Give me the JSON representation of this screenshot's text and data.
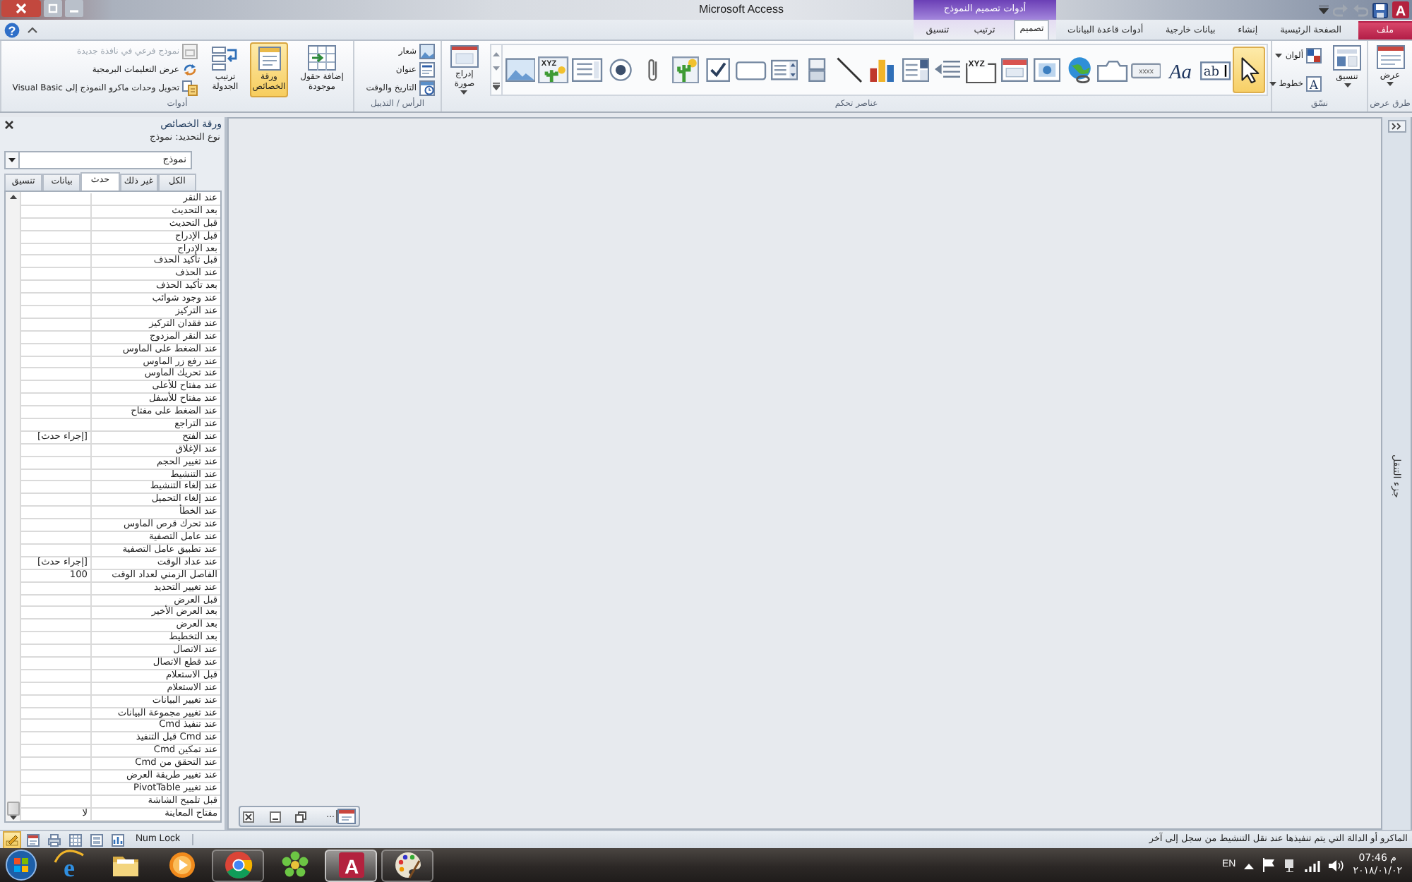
{
  "window": {
    "title": "Microsoft Access",
    "app_glyph": "A",
    "context_title": "أدوات تصميم النموذج",
    "help_glyph": "?"
  },
  "ribbon_tabs": [
    {
      "label": "ملف",
      "kind": "file",
      "selected": false
    },
    {
      "label": "الصفحة الرئيسية",
      "kind": "main",
      "selected": false
    },
    {
      "label": "إنشاء",
      "kind": "main",
      "selected": false
    },
    {
      "label": "بيانات خارجية",
      "kind": "main",
      "selected": false
    },
    {
      "label": "أدوات قاعدة البيانات",
      "kind": "main",
      "selected": false
    },
    {
      "label": "تصميم",
      "kind": "context",
      "selected": true
    },
    {
      "label": "ترتيب",
      "kind": "context",
      "selected": false
    },
    {
      "label": "تنسيق",
      "kind": "context",
      "selected": false
    }
  ],
  "ribbon": {
    "views": {
      "label": "طرق عرض",
      "view_button": "عرض"
    },
    "themes": {
      "label": "نسّق",
      "themes_button": "تنسيق",
      "colors_button": "ألوان",
      "fonts_button": "خطوط",
      "fonts_glyph": "A"
    },
    "controls": {
      "label": "عناصر تحكم",
      "gallery": [
        {
          "kind": "pointer",
          "selected": true
        },
        {
          "kind": "textbox",
          "glyph": "ab",
          "selected": false
        },
        {
          "kind": "label",
          "glyph": "Aa",
          "selected": false
        },
        {
          "kind": "button",
          "glyph": "xxxx",
          "selected": false
        },
        {
          "kind": "tab",
          "selected": false
        },
        {
          "kind": "hyperlink",
          "selected": false
        },
        {
          "kind": "browser",
          "selected": false
        },
        {
          "kind": "navigation",
          "selected": false
        },
        {
          "kind": "option_group",
          "glyph": "XYZ",
          "selected": false
        },
        {
          "kind": "page_break",
          "selected": false
        },
        {
          "kind": "combo",
          "selected": false
        },
        {
          "kind": "chart",
          "selected": false
        },
        {
          "kind": "line",
          "selected": false
        },
        {
          "kind": "toggle",
          "selected": false
        },
        {
          "kind": "listbox",
          "selected": false
        },
        {
          "kind": "rectangle",
          "selected": false
        },
        {
          "kind": "checkbox",
          "selected": false
        },
        {
          "kind": "unbound_object",
          "selected": false
        },
        {
          "kind": "attachment",
          "selected": false
        },
        {
          "kind": "option",
          "selected": false
        },
        {
          "kind": "subform",
          "selected": false
        },
        {
          "kind": "bound_object",
          "glyph": "XYZ",
          "selected": false
        },
        {
          "kind": "image",
          "selected": false
        }
      ],
      "insert_image": "إدراج صورة"
    },
    "header_footer": {
      "label": "الرأس / التذييل",
      "items": [
        {
          "label": "شعار",
          "kind": "logo"
        },
        {
          "label": "عنوان",
          "kind": "title"
        },
        {
          "label": "التاريخ والوقت",
          "kind": "date_time"
        }
      ]
    },
    "tools": {
      "label": "أدوات",
      "large": [
        {
          "label": "إضافة حقول موجودة",
          "kind": "add_fields",
          "on": false
        },
        {
          "label": "ورقة الخصائص",
          "kind": "property_sheet",
          "on": true
        },
        {
          "label": "ترتيب الجدولة",
          "kind": "tab_order",
          "on": false
        }
      ],
      "small": [
        {
          "label": "نموذج فرعي في نافذة جديدة",
          "kind": "subform",
          "disabled": true
        },
        {
          "label": "عرض التعليمات البرمجية",
          "kind": "code",
          "disabled": false
        },
        {
          "label": "تحويل وحدات ماكرو النموذج إلى Visual Basic",
          "kind": "convert",
          "disabled": false
        }
      ]
    }
  },
  "property_sheet": {
    "title": "ورقة الخصائص",
    "selection_type": "نوع التحديد: نموذج",
    "object": "نموذج",
    "tabs": [
      {
        "label": "الكل",
        "selected": false
      },
      {
        "label": "غير ذلك",
        "selected": false
      },
      {
        "label": "حدث",
        "selected": true
      },
      {
        "label": "بيانات",
        "selected": false
      },
      {
        "label": "تنسيق",
        "selected": false
      }
    ],
    "properties": [
      {
        "name": "عند النقر"
      },
      {
        "name": "بعد التحديث"
      },
      {
        "name": "قبل التحديث"
      },
      {
        "name": "قبل الإدراج"
      },
      {
        "name": "بعد الإدراج"
      },
      {
        "name": "قبل تأكيد الحذف"
      },
      {
        "name": "عند الحذف"
      },
      {
        "name": "بعد تأكيد الحذف"
      },
      {
        "name": "عند وجود شوائب"
      },
      {
        "name": "عند التركيز"
      },
      {
        "name": "عند فقدان التركيز"
      },
      {
        "name": "عند النقر المزدوج"
      },
      {
        "name": "عند الضغط على الماوس"
      },
      {
        "name": "عند رفع زر الماوس"
      },
      {
        "name": "عند تحريك الماوس"
      },
      {
        "name": "عند مفتاح للأعلى"
      },
      {
        "name": "عند مفتاح للأسفل"
      },
      {
        "name": "عند الضغط على مفتاح"
      },
      {
        "name": "عند التراجع"
      },
      {
        "name": "عند الفتح",
        "value": "[إجراء حدث]"
      },
      {
        "name": "عند الإغلاق"
      },
      {
        "name": "عند تغيير الحجم"
      },
      {
        "name": "عند التنشيط"
      },
      {
        "name": "عند إلغاء التنشيط"
      },
      {
        "name": "عند إلغاء التحميل"
      },
      {
        "name": "عند الخطأ"
      },
      {
        "name": "عند تحرك قرص الماوس"
      },
      {
        "name": "عند عامل التصفية"
      },
      {
        "name": "عند تطبيق عامل التصفية"
      },
      {
        "name": "عند عداد الوقت",
        "value": "[إجراء حدث]"
      },
      {
        "name": "الفاصل الزمني لعداد الوقت",
        "value": "100"
      },
      {
        "name": "عند تغيير التحديد"
      },
      {
        "name": "قبل العرض"
      },
      {
        "name": "بعد العرض الأخير"
      },
      {
        "name": "بعد العرض"
      },
      {
        "name": "بعد التخطيط"
      },
      {
        "name": "عند الاتصال"
      },
      {
        "name": "عند قطع الاتصال"
      },
      {
        "name": "قبل الاستعلام"
      },
      {
        "name": "عند الاستعلام"
      },
      {
        "name": "عند تغيير البيانات"
      },
      {
        "name": "عند تغيير مجموعة البيانات"
      },
      {
        "name": "عند تنفيذ Cmd"
      },
      {
        "name": "عند Cmd قبل التنفيذ"
      },
      {
        "name": "عند تمكين Cmd"
      },
      {
        "name": "عند التحقق من Cmd"
      },
      {
        "name": "عند تغيير طريقة العرض"
      },
      {
        "name": "عند تغيير PivotTable"
      },
      {
        "name": "قبل تلميح الشاشة"
      },
      {
        "name": "مفتاح المعاينة",
        "value": "لا"
      }
    ]
  },
  "workspace": {
    "minimized_window": {
      "title": "..."
    }
  },
  "navigation_pane": {
    "label": "جزء التنقل"
  },
  "status_bar": {
    "message": "الماكرو أو الدالة التي يتم تنفيذها عند نقل التنشيط من سجل إلى آخر",
    "indicator": "Num Lock",
    "views": [
      {
        "kind": "chart",
        "selected": false
      },
      {
        "kind": "layout",
        "selected": false
      },
      {
        "kind": "datasheet",
        "selected": false
      },
      {
        "kind": "print",
        "selected": false
      },
      {
        "kind": "form",
        "selected": false
      },
      {
        "kind": "design",
        "selected": true
      }
    ]
  },
  "taskbar": {
    "language": "EN",
    "time": "07:46 م",
    "date": "٢٠١٨/٠١/٠٢",
    "apps": [
      {
        "kind": "paint",
        "running": true,
        "selected": false
      },
      {
        "kind": "access",
        "glyph": "A",
        "running": true,
        "selected": true
      },
      {
        "kind": "icq",
        "running": false,
        "selected": false
      },
      {
        "kind": "chrome",
        "running": true,
        "selected": false
      },
      {
        "kind": "media_player",
        "running": false,
        "selected": false
      },
      {
        "kind": "explorer",
        "running": false,
        "selected": false
      },
      {
        "kind": "ie",
        "glyph": "e",
        "running": false,
        "selected": false
      }
    ]
  }
}
